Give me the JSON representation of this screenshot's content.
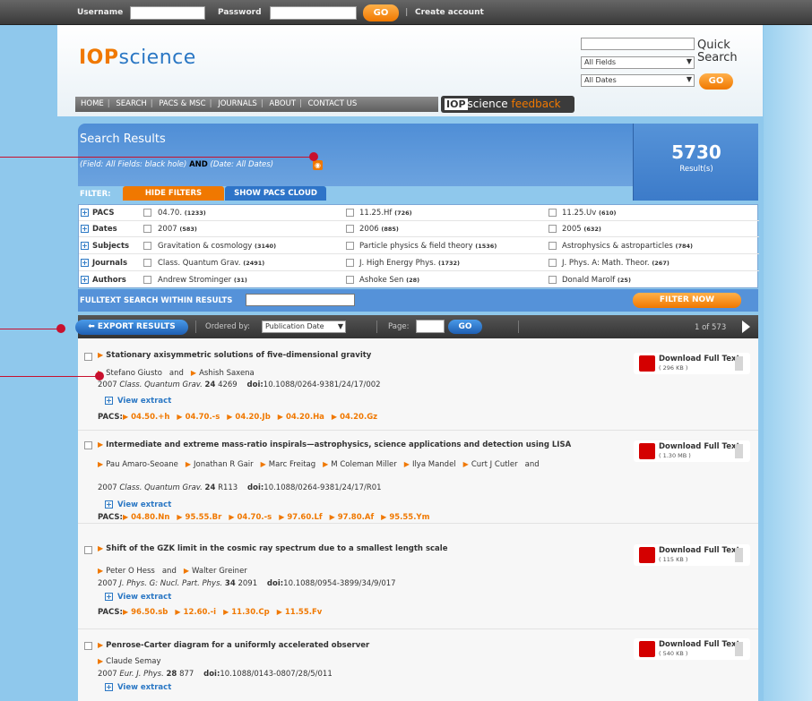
{
  "login": {
    "username_label": "Username",
    "password_label": "Password",
    "go_label": "GO",
    "create_account": "Create account"
  },
  "logo": {
    "bold": "IOP",
    "light": "science"
  },
  "quick_search": {
    "title_line1": "Quick",
    "title_line2": "Search",
    "fields_value": "All Fields",
    "dates_value": "All Dates",
    "go_label": "GO"
  },
  "nav": {
    "items": [
      "HOME",
      "SEARCH",
      "PACS & MSC",
      "JOURNALS",
      "ABOUT",
      "CONTACT US"
    ],
    "feedback_iop": "IOP",
    "feedback_science": "science",
    "feedback_word": "feedback"
  },
  "results": {
    "title": "Search Results",
    "query_part1": "(Field: All Fields: black hole)",
    "query_and": "AND",
    "query_part2": "(Date: All Dates)",
    "count": "5730",
    "count_label": "Result(s)",
    "filter_label": "FILTER:",
    "hide_filters": "HIDE FILTERS",
    "show_pacs": "SHOW PACS CLOUD",
    "filters": [
      {
        "category": "PACS",
        "items": [
          {
            "name": "04.70.",
            "count": "(1233)"
          },
          {
            "name": "11.25.Hf",
            "count": "(726)"
          },
          {
            "name": "11.25.Uv",
            "count": "(610)"
          }
        ]
      },
      {
        "category": "Dates",
        "items": [
          {
            "name": "2007",
            "count": "(583)"
          },
          {
            "name": "2006",
            "count": "(885)"
          },
          {
            "name": "2005",
            "count": "(632)"
          }
        ]
      },
      {
        "category": "Subjects",
        "items": [
          {
            "name": "Gravitation & cosmology",
            "count": "(3140)"
          },
          {
            "name": "Particle physics & field theory",
            "count": "(1536)"
          },
          {
            "name": "Astrophysics & astroparticles",
            "count": "(784)"
          }
        ]
      },
      {
        "category": "Journals",
        "items": [
          {
            "name": "Class. Quantum Grav.",
            "count": "(2491)"
          },
          {
            "name": "J. High Energy Phys.",
            "count": "(1732)"
          },
          {
            "name": "J. Phys. A: Math. Theor.",
            "count": "(267)"
          }
        ]
      },
      {
        "category": "Authors",
        "items": [
          {
            "name": "Andrew Strominger",
            "count": "(31)"
          },
          {
            "name": "Ashoke Sen",
            "count": "(28)"
          },
          {
            "name": "Donald Marolf",
            "count": "(25)"
          }
        ]
      }
    ],
    "fulltext_label": "FULLTEXT SEARCH WITHIN RESULTS",
    "filter_now": "FILTER NOW"
  },
  "sort": {
    "export": "EXPORT RESULTS",
    "ordered_by": "Ordered by:",
    "ordered_value": "Publication Date",
    "page_label": "Page:",
    "go_label": "GO",
    "page_info": "1 of 573"
  },
  "download_label": "Download Full Text",
  "view_extract": "View extract",
  "pacs_label": "PACS:",
  "doi_label": "doi:",
  "articles": [
    {
      "title": "Stationary axisymmetric solutions of five-dimensional gravity",
      "authors": [
        "Stefano Giusto",
        "and",
        "Ashish Saxena"
      ],
      "year": "2007",
      "journal": "Class. Quantum Grav.",
      "volume": "24",
      "page": "4269",
      "doi": "10.1088/0264-9381/24/17/002",
      "pacs": [
        "04.50.+h",
        "04.70.-s",
        "04.20.Jb",
        "04.20.Ha",
        "04.20.Gz"
      ],
      "size": "( 296 KB )"
    },
    {
      "title": "Intermediate and extreme mass-ratio inspirals—astrophysics, science applications and detection using LISA",
      "authors": [
        "Pau Amaro-Seoane",
        "Jonathan R Gair",
        "Marc Freitag",
        "M Coleman Miller",
        "Ilya Mandel",
        "Curt J Cutler",
        "and"
      ],
      "year": "2007",
      "journal": "Class. Quantum Grav.",
      "volume": "24",
      "page": "R113",
      "doi": "10.1088/0264-9381/24/17/R01",
      "pacs": [
        "04.80.Nn",
        "95.55.Br",
        "04.70.-s",
        "97.60.Lf",
        "97.80.Af",
        "95.55.Ym"
      ],
      "size": "( 1.30 MB )"
    },
    {
      "title": "Shift of the GZK limit in the cosmic ray spectrum due to a smallest length scale",
      "authors": [
        "Peter O Hess",
        "and",
        "Walter Greiner"
      ],
      "year": "2007",
      "journal": "J. Phys. G: Nucl. Part. Phys.",
      "volume": "34",
      "page": "2091",
      "doi": "10.1088/0954-3899/34/9/017",
      "pacs": [
        "96.50.sb",
        "12.60.-i",
        "11.30.Cp",
        "11.55.Fv"
      ],
      "size": "( 115 KB )"
    },
    {
      "title": "Penrose-Carter diagram for a uniformly accelerated observer",
      "authors": [
        "Claude Semay"
      ],
      "year": "2007",
      "journal": "Eur. J. Phys.",
      "volume": "28",
      "page": "877",
      "doi": "10.1088/0143-0807/28/5/011",
      "pacs": [],
      "size": "( 540 KB )"
    }
  ]
}
